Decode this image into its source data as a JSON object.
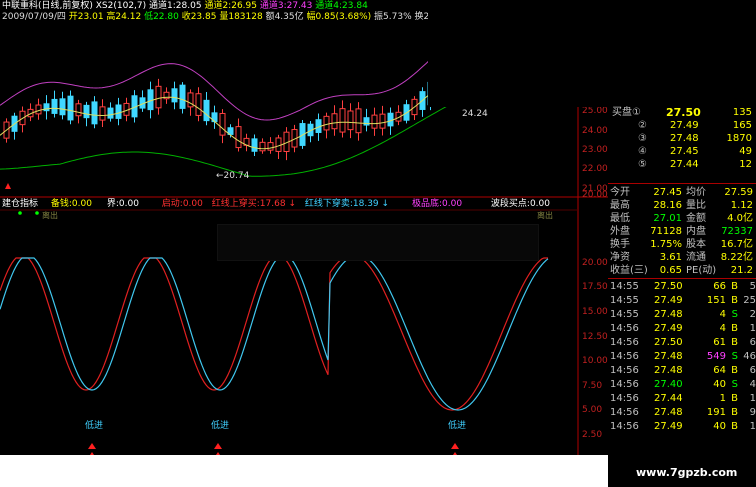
{
  "header": {
    "title": "中联重科(日线,前复权)",
    "xs2": "XS2(102,7)",
    "tongdao1": "通道1:28.05",
    "tongdao2": "通道2:26.95",
    "tongdao3": "通道3:27.43",
    "tongdao4": "通道4:23.84",
    "date": "2009/07/09/四",
    "open": "开23.01",
    "high": "高24.12",
    "low": "低22.80",
    "close": "收23.85",
    "volume": "量183128",
    "amount": "额4.35亿",
    "change": "幅0.85(3.68%)",
    "amplitude": "振5.73%",
    "turnover": "换2.45%"
  },
  "main_chart": {
    "low_label": "←20.74",
    "right_label": "24.24",
    "y_axis_labels": [
      "25.00",
      "24.00",
      "23.00",
      "22.00",
      "21.00",
      "20.00"
    ]
  },
  "indicator": {
    "name": "建仓指标",
    "beican": "备钱:0.00",
    "jie": "界:0.00",
    "qidong": "启动:0.00",
    "hongxian_up": "红线上穿买:17.68",
    "hongxian_down": "红线下穿卖:18.39",
    "jipin": "极品底:0.00",
    "boduan": "波段买点:0.00",
    "low_entry": "低进",
    "top_marker": "离出",
    "y_axis_labels": [
      "20.00",
      "17.50",
      "15.00",
      "12.50",
      "10.00",
      "7.50",
      "5.00",
      "2.50"
    ]
  },
  "quote_panel": {
    "buy1_label": "买盘①",
    "buy1_price": "27.50",
    "buy1_vol": "135",
    "buy2_label": "②",
    "buy2_price": "27.49",
    "buy2_vol": "165",
    "buy3_label": "③",
    "buy3_price": "27.48",
    "buy3_vol": "1870",
    "buy4_label": "④",
    "buy4_price": "27.45",
    "buy4_vol": "49",
    "buy5_label": "⑤",
    "buy5_price": "27.44",
    "buy5_vol": "12",
    "stats": [
      {
        "l1": "今开",
        "v1": "27.45",
        "l2": "均价",
        "v2": "27.59"
      },
      {
        "l1": "最高",
        "v1": "28.16",
        "l2": "量比",
        "v2": "1.12"
      },
      {
        "l1": "最低",
        "v1": "27.01",
        "l2": "金额",
        "v2": "4.0亿"
      },
      {
        "l1": "外盘",
        "v1": "71128",
        "l2": "内盘",
        "v2": "72337"
      },
      {
        "l1": "换手",
        "v1": "1.75%",
        "l2": "股本",
        "v2": "16.7亿"
      },
      {
        "l1": "净资",
        "v1": "3.61",
        "l2": "流通",
        "v2": "8.22亿"
      },
      {
        "l1": "收益(三)",
        "v1": "0.65",
        "l2": "PE(动)",
        "v2": "21.2"
      }
    ],
    "ticks": [
      {
        "t": "14:55",
        "p": "27.50",
        "v": "66",
        "s": "B",
        "n": "5"
      },
      {
        "t": "14:55",
        "p": "27.49",
        "v": "151",
        "s": "B",
        "n": "25"
      },
      {
        "t": "14:55",
        "p": "27.48",
        "v": "4",
        "s": "S",
        "n": "2"
      },
      {
        "t": "14:56",
        "p": "27.49",
        "v": "4",
        "s": "B",
        "n": "1"
      },
      {
        "t": "14:56",
        "p": "27.50",
        "v": "61",
        "s": "B",
        "n": "6"
      },
      {
        "t": "14:56",
        "p": "27.48",
        "v": "549",
        "s": "S",
        "n": "46"
      },
      {
        "t": "14:56",
        "p": "27.48",
        "v": "64",
        "s": "B",
        "n": "6"
      },
      {
        "t": "14:56",
        "p": "27.40",
        "v": "40",
        "s": "S",
        "n": "4"
      },
      {
        "t": "14:56",
        "p": "27.44",
        "v": "1",
        "s": "B",
        "n": "1"
      },
      {
        "t": "14:56",
        "p": "27.48",
        "v": "191",
        "s": "B",
        "n": "9"
      },
      {
        "t": "14:56",
        "p": "27.49",
        "v": "40",
        "s": "B",
        "n": "1"
      }
    ]
  },
  "footer": {
    "site": "www.7gpzb.com"
  },
  "colors": {
    "red": "#ff3030",
    "cyan": "#40d0ff",
    "yellow": "#ffff00",
    "magenta": "#ff40ff",
    "green": "#00c000",
    "white": "#ffffff"
  }
}
